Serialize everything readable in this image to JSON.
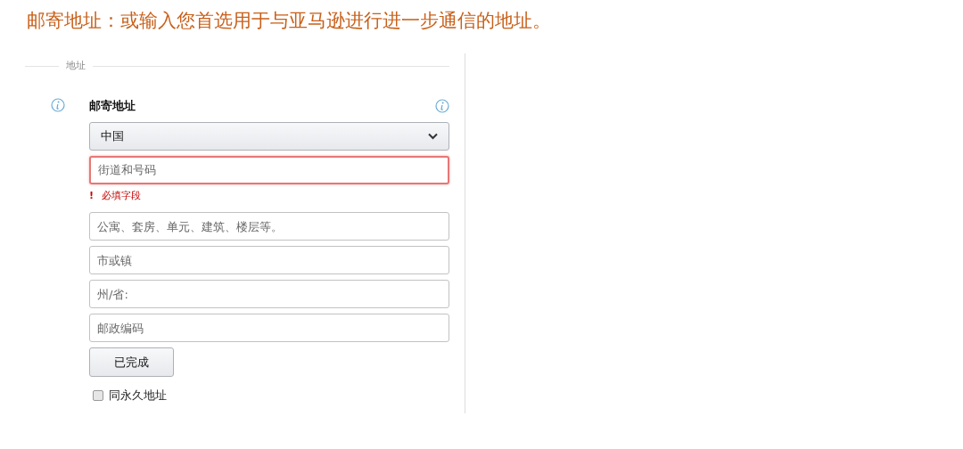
{
  "heading": "邮寄地址：或输入您首选用于与亚马逊进行进一步通信的地址。",
  "fieldset": {
    "legend": "地址",
    "label": "邮寄地址",
    "fields": [
      {
        "kind": "select",
        "value": "中国"
      },
      {
        "kind": "text",
        "placeholder": "街道和号码",
        "error": true,
        "error_message": "必填字段",
        "error_mark": "!"
      },
      {
        "kind": "text",
        "placeholder": "公寓、套房、单元、建筑、楼层等。",
        "error": false
      },
      {
        "kind": "text",
        "placeholder": "市或镇",
        "error": false
      },
      {
        "kind": "text",
        "placeholder": "州/省:",
        "error": false
      },
      {
        "kind": "text",
        "placeholder": "邮政编码",
        "error": false
      }
    ],
    "button": "已完成",
    "checkbox": {
      "label": "同永久地址",
      "checked": false
    }
  }
}
